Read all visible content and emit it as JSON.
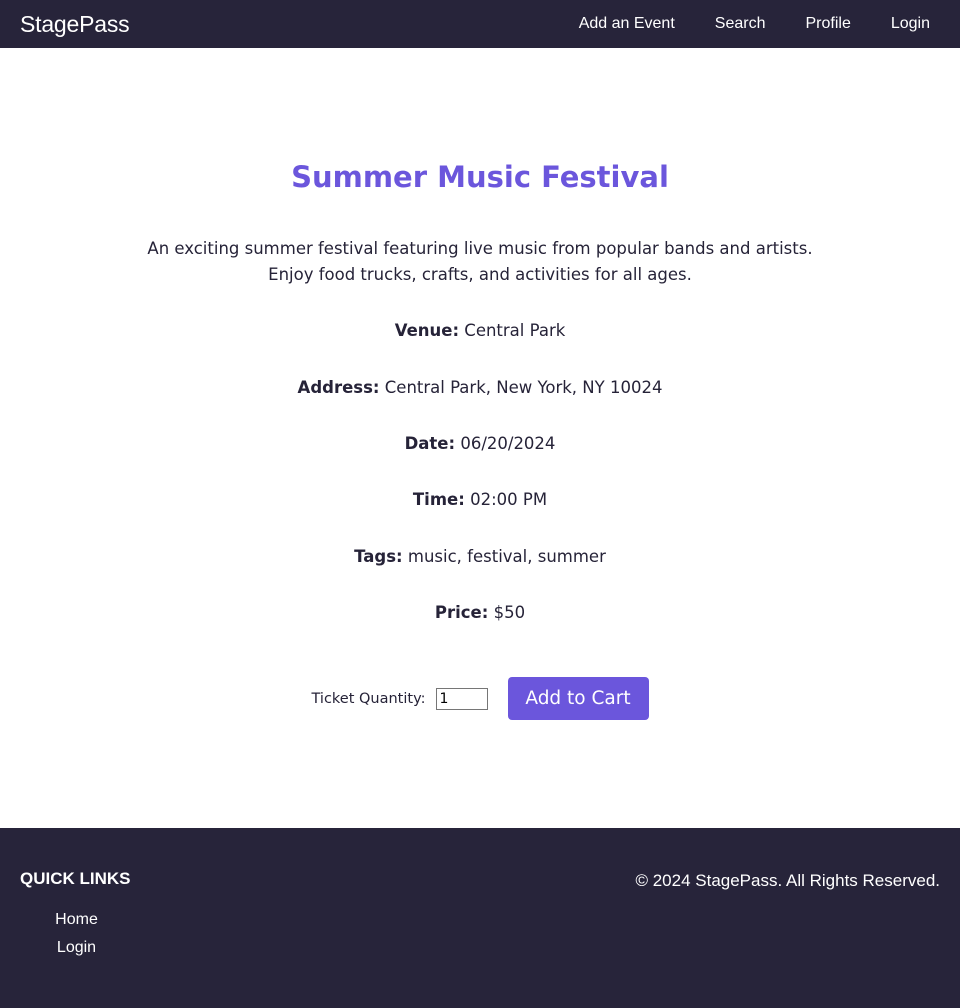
{
  "header": {
    "brand": "StagePass",
    "nav": [
      "Add an Event",
      "Search",
      "Profile",
      "Login"
    ]
  },
  "event": {
    "title": "Summer Music Festival",
    "description": "An exciting summer festival featuring live music from popular bands and artists. Enjoy food trucks, crafts, and activities for all ages.",
    "details": [
      {
        "label": "Venue:",
        "value": "Central Park"
      },
      {
        "label": "Address:",
        "value": "Central Park, New York, NY 10024"
      },
      {
        "label": "Date:",
        "value": "06/20/2024"
      },
      {
        "label": "Time:",
        "value": "02:00 PM"
      },
      {
        "label": "Tags:",
        "value": "music, festival, summer"
      },
      {
        "label": "Price:",
        "value": "$50"
      }
    ]
  },
  "purchase": {
    "quantity_label": "Ticket Quantity:",
    "quantity_value": "1",
    "add_button": "Add to Cart"
  },
  "footer": {
    "quick_links_title": "QUICK LINKS",
    "links": [
      "Home",
      "Login"
    ],
    "copyright": "© 2024 StagePass. All Rights Reserved."
  },
  "colors": {
    "nav_background": "#27243a",
    "accent": "#6b56dc",
    "text": "#262338"
  }
}
